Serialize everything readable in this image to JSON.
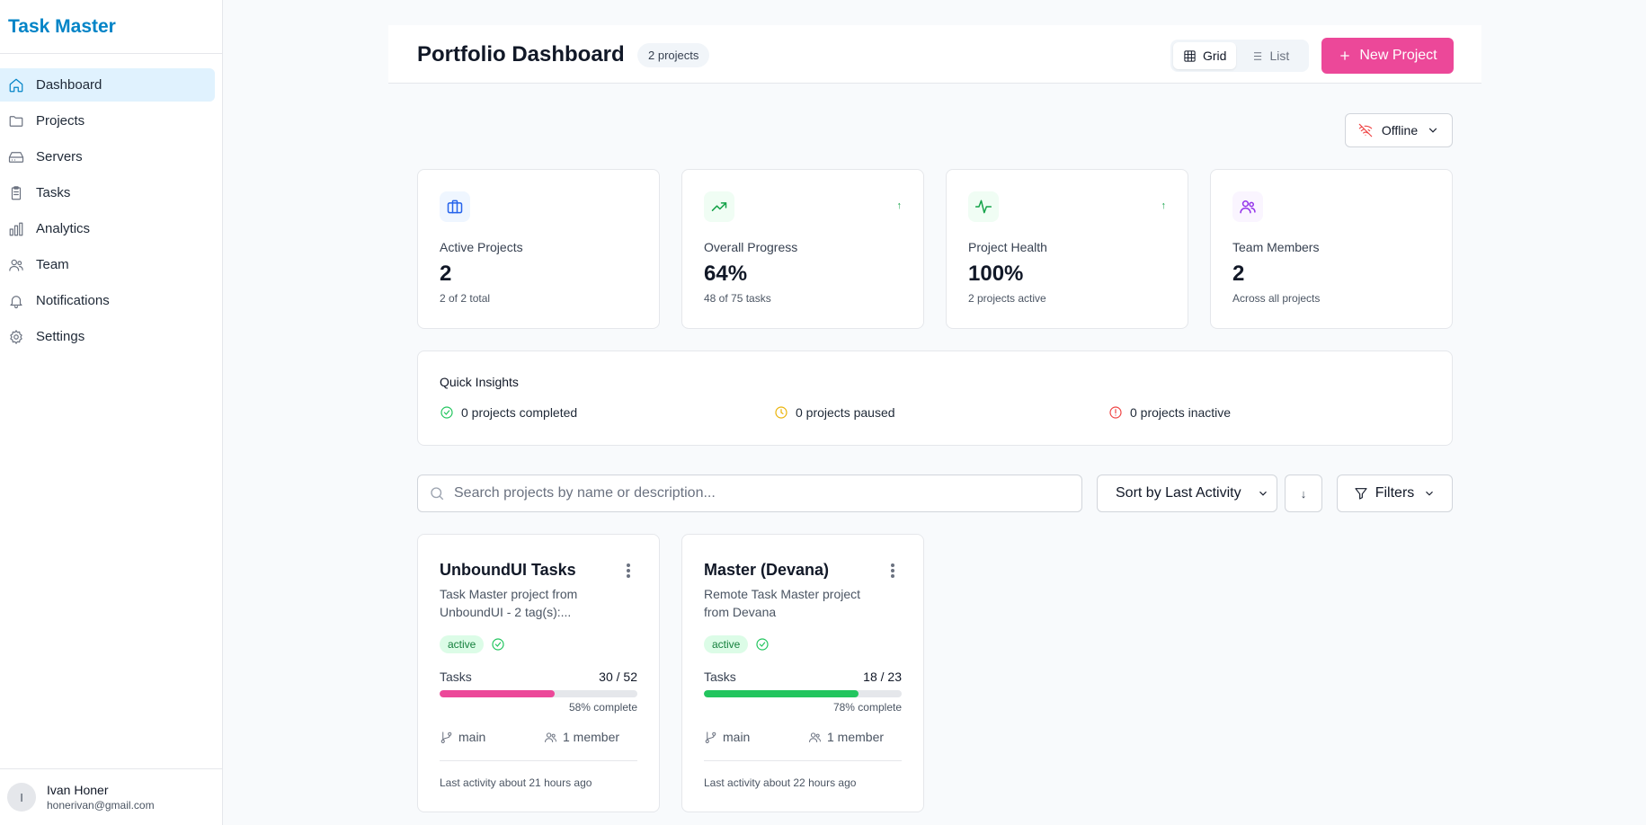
{
  "app": {
    "name": "Task Master"
  },
  "sidebar": {
    "items": [
      {
        "label": "Dashboard",
        "icon": "home-icon",
        "active": true
      },
      {
        "label": "Projects",
        "icon": "folder-icon"
      },
      {
        "label": "Servers",
        "icon": "server-icon"
      },
      {
        "label": "Tasks",
        "icon": "clipboard-icon"
      },
      {
        "label": "Analytics",
        "icon": "bar-chart-icon"
      },
      {
        "label": "Team",
        "icon": "users-icon"
      },
      {
        "label": "Notifications",
        "icon": "bell-icon"
      },
      {
        "label": "Settings",
        "icon": "gear-icon"
      }
    ]
  },
  "user": {
    "initial": "I",
    "name": "Ivan Honer",
    "email": "honerivan@gmail.com"
  },
  "header": {
    "title": "Portfolio Dashboard",
    "project_count": "2 projects",
    "view_grid": "Grid",
    "view_list": "List",
    "new_project": "New Project"
  },
  "connection": {
    "status": "Offline"
  },
  "stats": [
    {
      "label": "Active Projects",
      "value": "2",
      "sub": "2 of 2 total",
      "icon": "briefcase-icon",
      "color": "#2563eb",
      "bg": "#eff6ff",
      "trend": ""
    },
    {
      "label": "Overall Progress",
      "value": "64%",
      "sub": "48 of 75 tasks",
      "icon": "trending-up-icon",
      "color": "#16a34a",
      "bg": "#f0fdf4",
      "trend": "↑"
    },
    {
      "label": "Project Health",
      "value": "100%",
      "sub": "2 projects active",
      "icon": "activity-icon",
      "color": "#16a34a",
      "bg": "#f0fdf4",
      "trend": "↑"
    },
    {
      "label": "Team Members",
      "value": "2",
      "sub": "Across all projects",
      "icon": "users-icon",
      "color": "#9333ea",
      "bg": "#faf5ff",
      "trend": ""
    }
  ],
  "insights": {
    "title": "Quick Insights",
    "completed": "0 projects completed",
    "paused": "0 projects paused",
    "inactive": "0 projects inactive"
  },
  "toolbar": {
    "search_placeholder": "Search projects by name or description...",
    "sort_label": "Sort by Last Activity",
    "sort_direction": "↓",
    "filters_label": "Filters"
  },
  "tasks_label": "Tasks",
  "projects": [
    {
      "name": "UnboundUI Tasks",
      "description": "Task Master project from UnboundUI - 2 tag(s):...",
      "status": "active",
      "tasks": "30 / 52",
      "progress": 0.58,
      "progress_color": "#ec4899",
      "percent_label": "58% complete",
      "branch": "main",
      "members": "1 member",
      "last_activity": "Last activity about 21 hours ago"
    },
    {
      "name": "Master (Devana)",
      "description": "Remote Task Master project from Devana",
      "status": "active",
      "tasks": "18 / 23",
      "progress": 0.78,
      "progress_color": "#22c55e",
      "percent_label": "78% complete",
      "branch": "main",
      "members": "1 member",
      "last_activity": "Last activity about 22 hours ago"
    }
  ]
}
